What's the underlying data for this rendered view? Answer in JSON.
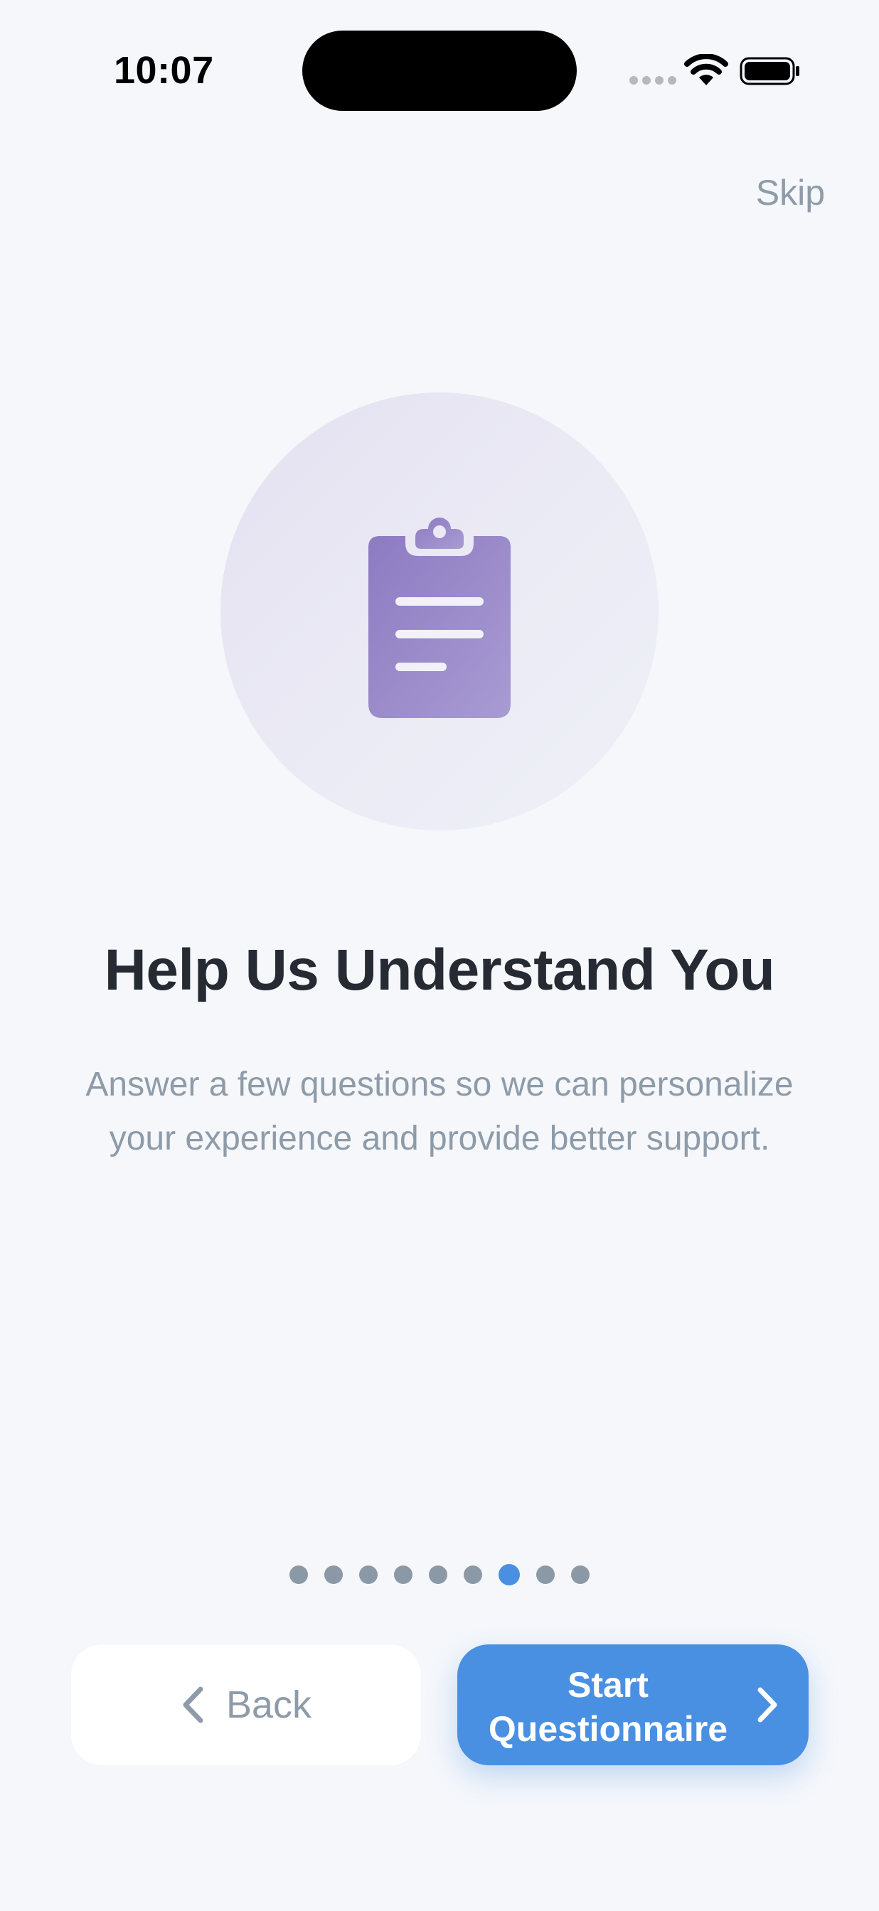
{
  "status_bar": {
    "time": "10:07"
  },
  "header": {
    "skip_label": "Skip"
  },
  "illustration": {
    "icon": "clipboard-icon",
    "circle_color": "#e6e4f1",
    "icon_color": "#9685c7"
  },
  "content": {
    "title": "Help Us Understand You",
    "description": "Answer a few questions so we can personalize your experience and provide better support."
  },
  "pagination": {
    "total_pages": 9,
    "current_page": 7,
    "active_color": "#4a90e2",
    "inactive_color": "#8b99a6"
  },
  "footer": {
    "back_label": "Back",
    "back_icon": "chevron-left-icon",
    "primary_label_line1": "Start",
    "primary_label_line2": "Questionnaire",
    "primary_icon": "chevron-right-icon",
    "primary_color": "#4a90e2"
  }
}
